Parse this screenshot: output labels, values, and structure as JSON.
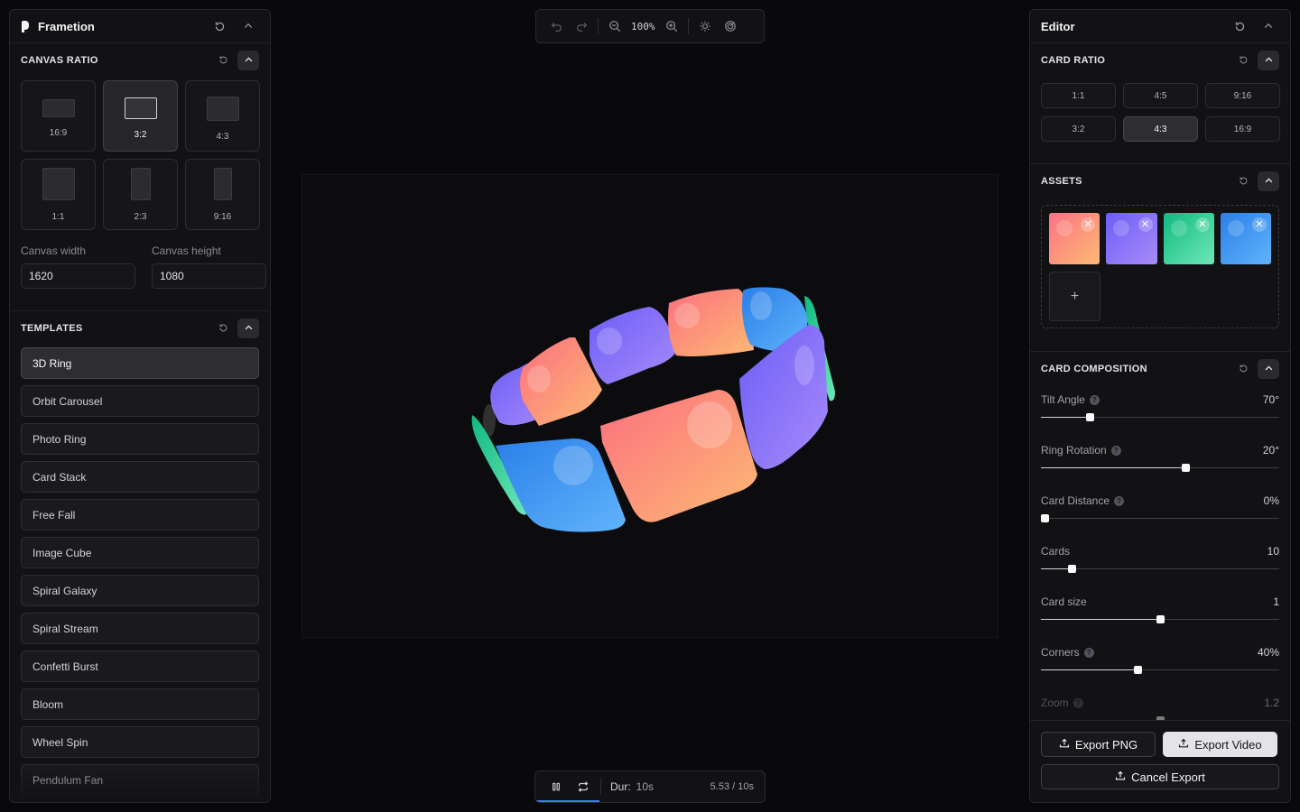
{
  "left_panel": {
    "app_name": "Frametion",
    "canvas_ratio": {
      "title": "CANVAS RATIO",
      "options": [
        {
          "label": "16:9",
          "active": false
        },
        {
          "label": "3:2",
          "active": true
        },
        {
          "label": "4:3",
          "active": false
        },
        {
          "label": "1:1",
          "active": false
        },
        {
          "label": "2:3",
          "active": false
        },
        {
          "label": "9:16",
          "active": false
        }
      ],
      "width_label": "Canvas width",
      "width_value": "1620",
      "height_label": "Canvas height",
      "height_value": "1080"
    },
    "templates": {
      "title": "TEMPLATES",
      "items": [
        {
          "label": "3D Ring",
          "active": true
        },
        {
          "label": "Orbit Carousel",
          "active": false
        },
        {
          "label": "Photo Ring",
          "active": false
        },
        {
          "label": "Card Stack",
          "active": false
        },
        {
          "label": "Free Fall",
          "active": false
        },
        {
          "label": "Image Cube",
          "active": false
        },
        {
          "label": "Spiral Galaxy",
          "active": false
        },
        {
          "label": "Spiral Stream",
          "active": false
        },
        {
          "label": "Confetti Burst",
          "active": false
        },
        {
          "label": "Bloom",
          "active": false
        },
        {
          "label": "Wheel Spin",
          "active": false
        },
        {
          "label": "Pendulum Fan",
          "active": false
        }
      ]
    }
  },
  "toolbar": {
    "zoom": "100%",
    "icons": [
      "undo-icon",
      "redo-icon",
      "zoom-out-icon",
      "zoom-in-icon",
      "sun-icon",
      "target-icon"
    ]
  },
  "playback": {
    "dur_label": "Dur:",
    "dur_value": "10s",
    "time": "5.53 / 10s",
    "progress": 0.553
  },
  "right_panel": {
    "title": "Editor",
    "card_ratio": {
      "title": "CARD RATIO",
      "options": [
        {
          "label": "1:1",
          "active": false
        },
        {
          "label": "4:5",
          "active": false
        },
        {
          "label": "9:16",
          "active": false
        },
        {
          "label": "3:2",
          "active": false
        },
        {
          "label": "4:3",
          "active": true
        },
        {
          "label": "16:9",
          "active": false
        }
      ]
    },
    "assets": {
      "title": "ASSETS",
      "items": [
        {
          "name": "coral-gradient",
          "from": "#fb7185",
          "to": "#fdba74"
        },
        {
          "name": "violet-gradient",
          "from": "#6d5df6",
          "to": "#a78bfa"
        },
        {
          "name": "green-gradient",
          "from": "#10b981",
          "to": "#6ee7b7"
        },
        {
          "name": "blue-gradient",
          "from": "#2b7fe8",
          "to": "#60b4fb"
        }
      ],
      "add_label": "+"
    },
    "card_composition": {
      "title": "CARD COMPOSITION",
      "sliders": [
        {
          "label": "Tilt Angle",
          "value": "70°",
          "fraction": 0.205,
          "help": true
        },
        {
          "label": "Ring Rotation",
          "value": "20°",
          "fraction": 0.606,
          "help": true
        },
        {
          "label": "Card Distance",
          "value": "0%",
          "fraction": 0.0,
          "help": true
        },
        {
          "label": "Cards",
          "value": "10",
          "fraction": 0.129,
          "help": false
        },
        {
          "label": "Card size",
          "value": "1",
          "fraction": 0.5,
          "help": false
        },
        {
          "label": "Corners",
          "value": "40%",
          "fraction": 0.405,
          "help": true
        },
        {
          "label": "Zoom",
          "value": "1.2",
          "fraction": 0.5,
          "help": true
        }
      ]
    },
    "export_png": "Export PNG",
    "export_video": "Export Video",
    "cancel_export": "Cancel Export"
  }
}
